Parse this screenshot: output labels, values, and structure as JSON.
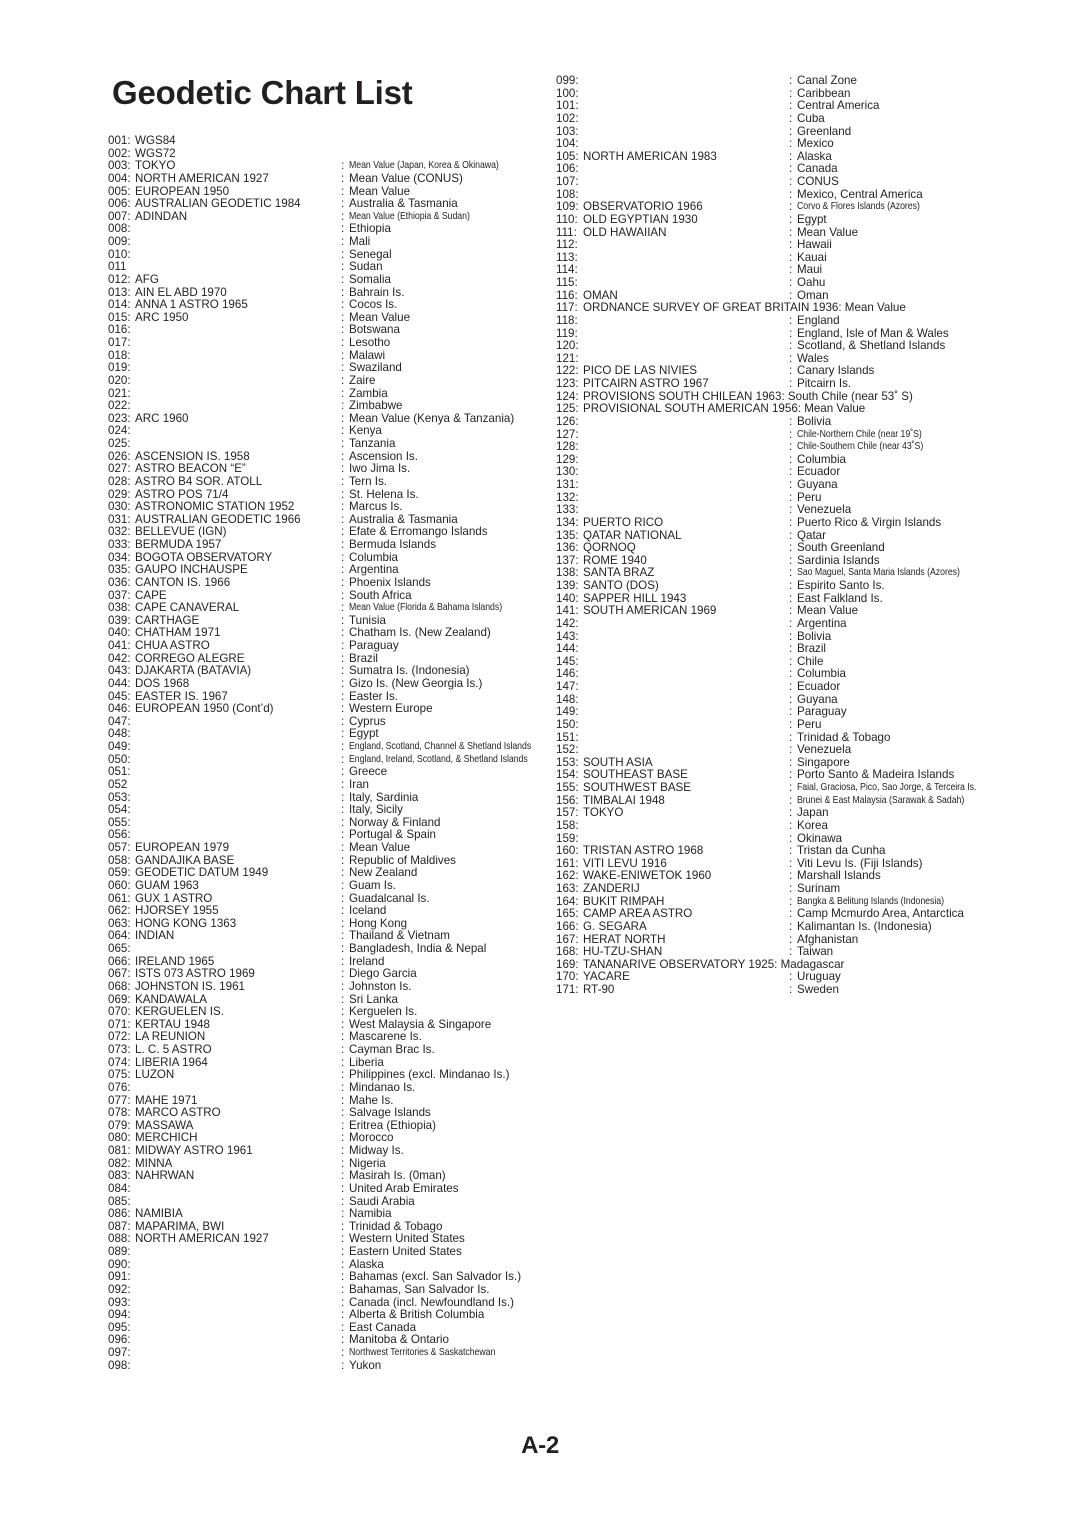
{
  "document": {
    "title": "Geodetic Chart List",
    "footer_page_label": "A-2",
    "separator": ":",
    "text_color": "#231f20",
    "background_color": "#ffffff"
  },
  "left_column": {
    "entries": [
      {
        "num": "001:",
        "name": "WGS84",
        "desc": ""
      },
      {
        "num": "002:",
        "name": "WGS72",
        "desc": ""
      },
      {
        "num": "003:",
        "name": "TOKYO",
        "desc": "Mean Value (Japan, Korea & Okinawa)",
        "condensed": true
      },
      {
        "num": "004:",
        "name": "NORTH AMERICAN 1927",
        "desc": "Mean Value (CONUS)"
      },
      {
        "num": "005:",
        "name": "EUROPEAN 1950",
        "desc": "Mean Value"
      },
      {
        "num": "006:",
        "name": "AUSTRALIAN GEODETIC 1984",
        "desc": "Australia & Tasmania"
      },
      {
        "num": "007:",
        "name": "ADINDAN",
        "desc": "Mean Value (Ethiopia & Sudan)",
        "condensed": true
      },
      {
        "num": "008:",
        "name": "",
        "desc": "Ethiopia"
      },
      {
        "num": "009:",
        "name": "",
        "desc": "Mali"
      },
      {
        "num": "010:",
        "name": "",
        "desc": "Senegal"
      },
      {
        "num": "011",
        "name": "",
        "desc": "Sudan"
      },
      {
        "num": "012:",
        "name": "AFG",
        "desc": "Somalia"
      },
      {
        "num": "013:",
        "name": "AIN EL ABD 1970",
        "desc": "Bahrain Is."
      },
      {
        "num": "014:",
        "name": "ANNA 1 ASTRO 1965",
        "desc": "Cocos Is."
      },
      {
        "num": "015:",
        "name": "ARC 1950",
        "desc": "Mean Value"
      },
      {
        "num": "016:",
        "name": "",
        "desc": "Botswana"
      },
      {
        "num": "017:",
        "name": "",
        "desc": "Lesotho"
      },
      {
        "num": "018:",
        "name": "",
        "desc": "Malawi"
      },
      {
        "num": "019:",
        "name": "",
        "desc": "Swaziland"
      },
      {
        "num": "020:",
        "name": "",
        "desc": "Zaire"
      },
      {
        "num": "021:",
        "name": "",
        "desc": "Zambia"
      },
      {
        "num": "022:",
        "name": "",
        "desc": "Zimbabwe"
      },
      {
        "num": "023:",
        "name": "ARC 1960",
        "desc": "Mean Value (Kenya & Tanzania)"
      },
      {
        "num": "024:",
        "name": "",
        "desc": "Kenya"
      },
      {
        "num": "025:",
        "name": "",
        "desc": "Tanzania"
      },
      {
        "num": "026:",
        "name": "ASCENSION IS. 1958",
        "desc": "Ascension Is."
      },
      {
        "num": "027:",
        "name": "ASTRO BEACON “E”",
        "desc": "Iwo Jima Is."
      },
      {
        "num": "028:",
        "name": "ASTRO B4 SOR. ATOLL",
        "desc": "Tern Is."
      },
      {
        "num": "029:",
        "name": "ASTRO POS 71/4",
        "desc": "St. Helena Is."
      },
      {
        "num": "030:",
        "name": "ASTRONOMIC STATION 1952",
        "desc": "Marcus Is."
      },
      {
        "num": "031:",
        "name": "AUSTRALIAN GEODETIC 1966",
        "desc": "Australia & Tasmania"
      },
      {
        "num": "032:",
        "name": "BELLEVUE (IGN)",
        "desc": "Efate & Erromango Islands"
      },
      {
        "num": "033:",
        "name": "BERMUDA 1957",
        "desc": "Bermuda Islands"
      },
      {
        "num": "034:",
        "name": "BOGOTA OBSERVATORY",
        "desc": "Columbia"
      },
      {
        "num": "035:",
        "name": "GAUPO INCHAUSPE",
        "desc": "Argentina"
      },
      {
        "num": "036:",
        "name": "CANTON IS. 1966",
        "desc": "Phoenix Islands"
      },
      {
        "num": "037:",
        "name": "CAPE",
        "desc": "South Africa"
      },
      {
        "num": "038:",
        "name": "CAPE CANAVERAL",
        "desc": "Mean Value (Florida & Bahama Islands)",
        "condensed": true
      },
      {
        "num": "039:",
        "name": "CARTHAGE",
        "desc": "Tunisia"
      },
      {
        "num": "040:",
        "name": "CHATHAM 1971",
        "desc": "Chatham Is. (New Zealand)"
      },
      {
        "num": "041:",
        "name": "CHUA ASTRO",
        "desc": "Paraguay"
      },
      {
        "num": "042:",
        "name": "CORREGO ALEGRE",
        "desc": "Brazil"
      },
      {
        "num": "043:",
        "name": "DJAKARTA (BATAVIA)",
        "desc": "Sumatra Is. (Indonesia)"
      },
      {
        "num": "044:",
        "name": "DOS 1968",
        "desc": "Gizo Is. (New Georgia Is.)"
      },
      {
        "num": "045:",
        "name": "EASTER IS. 1967",
        "desc": "Easter Is."
      },
      {
        "num": "046:",
        "name": "EUROPEAN 1950 (Cont’d)",
        "desc": "Western Europe"
      },
      {
        "num": "047:",
        "name": "",
        "desc": "Cyprus"
      },
      {
        "num": "048:",
        "name": "",
        "desc": "Egypt"
      },
      {
        "num": "049:",
        "name": "",
        "desc": "England, Scotland, Channel & Shetland Islands",
        "condensed": true
      },
      {
        "num": "050:",
        "name": "",
        "desc": "England, Ireland, Scotland, &  Shetland Islands",
        "condensed": true
      },
      {
        "num": "051:",
        "name": "",
        "desc": "Greece"
      },
      {
        "num": "052",
        "name": "",
        "desc": "Iran"
      },
      {
        "num": "053:",
        "name": "",
        "desc": "Italy, Sardinia"
      },
      {
        "num": "054:",
        "name": "",
        "desc": "Italy, Sicily"
      },
      {
        "num": "055:",
        "name": "",
        "desc": "Norway & Finland"
      },
      {
        "num": "056:",
        "name": "",
        "desc": "Portugal & Spain"
      },
      {
        "num": "057:",
        "name": "EUROPEAN 1979",
        "desc": "Mean Value"
      },
      {
        "num": "058:",
        "name": "GANDAJIKA BASE",
        "desc": "Republic of Maldives"
      },
      {
        "num": "059:",
        "name": "GEODETIC DATUM 1949",
        "desc": "New Zealand"
      },
      {
        "num": "060:",
        "name": "GUAM 1963",
        "desc": "Guam Is."
      },
      {
        "num": "061:",
        "name": "GUX 1 ASTRO",
        "desc": "Guadalcanal Is."
      },
      {
        "num": "062:",
        "name": "HJORSEY 1955",
        "desc": "Iceland"
      },
      {
        "num": "063:",
        "name": "HONG KONG 1363",
        "desc": "Hong Kong"
      },
      {
        "num": "064:",
        "name": "INDIAN",
        "desc": "Thailand & Vietnam"
      },
      {
        "num": "065:",
        "name": "",
        "desc": "Bangladesh, India & Nepal"
      },
      {
        "num": "066:",
        "name": "IRELAND 1965",
        "desc": "Ireland"
      },
      {
        "num": "067:",
        "name": "ISTS 073 ASTRO 1969",
        "desc": "Diego Garcia"
      },
      {
        "num": "068:",
        "name": "JOHNSTON IS. 1961",
        "desc": "Johnston Is."
      },
      {
        "num": "069:",
        "name": "KANDAWALA",
        "desc": "Sri Lanka"
      },
      {
        "num": "070:",
        "name": "KERGUELEN IS.",
        "desc": "Kerguelen Is."
      },
      {
        "num": "071:",
        "name": "KERTAU 1948",
        "desc": "West Malaysia & Singapore"
      },
      {
        "num": "072:",
        "name": "LA REUNION",
        "desc": "Mascarene Is."
      },
      {
        "num": "073:",
        "name": "L. C. 5 ASTRO",
        "desc": "Cayman Brac Is."
      },
      {
        "num": "074:",
        "name": "LIBERIA 1964",
        "desc": "Liberia"
      },
      {
        "num": "075:",
        "name": "LUZON",
        "desc": "Philippines (excl. Mindanao Is.)"
      },
      {
        "num": "076:",
        "name": "",
        "desc": "Mindanao Is."
      },
      {
        "num": "077:",
        "name": "MAHE 1971",
        "desc": "Mahe Is."
      },
      {
        "num": "078:",
        "name": "MARCO ASTRO",
        "desc": "Salvage Islands"
      },
      {
        "num": "079:",
        "name": "MASSAWA",
        "desc": "Eritrea (Ethiopia)"
      },
      {
        "num": "080:",
        "name": "MERCHICH",
        "desc": "Morocco"
      },
      {
        "num": "081:",
        "name": "MIDWAY ASTRO 1961",
        "desc": "Midway Is."
      },
      {
        "num": "082:",
        "name": "MINNA",
        "desc": "Nigeria"
      },
      {
        "num": "083:",
        "name": "NAHRWAN",
        "desc": "Masirah Is. (0man)"
      },
      {
        "num": "084:",
        "name": "",
        "desc": "United Arab Emirates"
      },
      {
        "num": "085:",
        "name": "",
        "desc": "Saudi Arabia"
      },
      {
        "num": "086:",
        "name": "NAMIBIA",
        "desc": "Namibia"
      },
      {
        "num": "087:",
        "name": "MAPARIMA, BWI",
        "desc": "Trinidad & Tobago"
      },
      {
        "num": "088:",
        "name": "NORTH AMERICAN 1927",
        "desc": "Western United States"
      },
      {
        "num": "089:",
        "name": "",
        "desc": "Eastern United States"
      },
      {
        "num": "090:",
        "name": "",
        "desc": "Alaska"
      },
      {
        "num": "091:",
        "name": "",
        "desc": "Bahamas (excl. San Salvador Is.)"
      },
      {
        "num": "092:",
        "name": "",
        "desc": "Bahamas, San Salvador Is."
      },
      {
        "num": "093:",
        "name": "",
        "desc": "Canada (incl. Newfoundland Is.)"
      },
      {
        "num": "094:",
        "name": "",
        "desc": "Alberta & British Columbia"
      },
      {
        "num": "095:",
        "name": "",
        "desc": "East Canada"
      },
      {
        "num": "096:",
        "name": "",
        "desc": "Manitoba & Ontario"
      },
      {
        "num": "097:",
        "name": "",
        "desc": "Northwest Territories & Saskatchewan",
        "condensed": true
      },
      {
        "num": "098:",
        "name": "",
        "desc": "Yukon"
      }
    ]
  },
  "right_column": {
    "entries": [
      {
        "num": "099:",
        "name": "",
        "desc": "Canal Zone"
      },
      {
        "num": "100:",
        "name": "",
        "desc": "Caribbean"
      },
      {
        "num": "101:",
        "name": "",
        "desc": "Central America"
      },
      {
        "num": "102:",
        "name": "",
        "desc": "Cuba"
      },
      {
        "num": "103:",
        "name": "",
        "desc": "Greenland"
      },
      {
        "num": "104:",
        "name": "",
        "desc": "Mexico"
      },
      {
        "num": "105:",
        "name": "NORTH AMERICAN 1983",
        "desc": "Alaska"
      },
      {
        "num": "106:",
        "name": "",
        "desc": "Canada"
      },
      {
        "num": "107:",
        "name": "",
        "desc": "CONUS"
      },
      {
        "num": "108:",
        "name": "",
        "desc": "Mexico, Central America"
      },
      {
        "num": "109:",
        "name": "OBSERVATORIO 1966",
        "desc": "Corvo & Flores Islands (Azores)",
        "condensed": true
      },
      {
        "num": "110:",
        "name": "OLD EGYPTIAN 1930",
        "desc": "Egypt"
      },
      {
        "num": "111:",
        "name": "OLD HAWAIIAN",
        "desc": "Mean Value"
      },
      {
        "num": "112:",
        "name": "",
        "desc": "Hawaii"
      },
      {
        "num": "113:",
        "name": "",
        "desc": "Kauai"
      },
      {
        "num": "114:",
        "name": "",
        "desc": "Maui"
      },
      {
        "num": "115:",
        "name": "",
        "desc": "Oahu"
      },
      {
        "num": "116:",
        "name": "OMAN",
        "desc": "Oman"
      },
      {
        "num": "117:",
        "wide": true,
        "inline": "ORDNANCE SURVEY OF GREAT BRITAIN 1936: Mean Value"
      },
      {
        "num": "118:",
        "name": "",
        "desc": "England"
      },
      {
        "num": "119:",
        "name": "",
        "desc": "England, Isle of Man & Wales"
      },
      {
        "num": "120:",
        "name": "",
        "desc": "Scotland, & Shetland Islands"
      },
      {
        "num": "121:",
        "name": "",
        "desc": "Wales"
      },
      {
        "num": "122:",
        "name": "PICO DE LAS NIVIES",
        "desc": "Canary Islands"
      },
      {
        "num": "123:",
        "name": "PITCAIRN ASTRO 1967",
        "desc": "Pitcairn Is."
      },
      {
        "num": "124:",
        "wide": true,
        "inline": "PROVISIONS SOUTH CHILEAN 1963: South Chile (near 53˚ S)"
      },
      {
        "num": "125:",
        "wide": true,
        "inline": "PROVISIONAL SOUTH AMERICAN 1956: Mean Value"
      },
      {
        "num": "126:",
        "name": "",
        "desc": "Bolivia"
      },
      {
        "num": "127:",
        "name": "",
        "desc": "Chile-Northern Chile (near 19˚S)",
        "condensed": true
      },
      {
        "num": "128:",
        "name": "",
        "desc": "Chile-Southern Chile (near 43˚S)",
        "condensed": true
      },
      {
        "num": "129:",
        "name": "",
        "desc": "Columbia"
      },
      {
        "num": "130:",
        "name": "",
        "desc": "Ecuador"
      },
      {
        "num": "131:",
        "name": "",
        "desc": "Guyana"
      },
      {
        "num": "132:",
        "name": "",
        "desc": "Peru"
      },
      {
        "num": "133:",
        "name": "",
        "desc": "Venezuela"
      },
      {
        "num": "134:",
        "name": "PUERTO RICO",
        "desc": "Puerto Rico & Virgin Islands"
      },
      {
        "num": "135:",
        "name": "QATAR NATIONAL",
        "desc": "Qatar"
      },
      {
        "num": "136:",
        "name": "QORNOQ",
        "desc": "South Greenland"
      },
      {
        "num": "137:",
        "name": "ROME 1940",
        "desc": "Sardinia Islands"
      },
      {
        "num": "138:",
        "name": "SANTA BRAZ",
        "desc": "Sao Maguel, Santa Maria Islands (Azores)",
        "condensed": true
      },
      {
        "num": "139:",
        "name": "SANTO (DOS)",
        "desc": "Espirito Santo Is."
      },
      {
        "num": "140:",
        "name": "SAPPER HILL 1943",
        "desc": "East Falkland Is."
      },
      {
        "num": "141:",
        "name": "SOUTH AMERICAN 1969",
        "desc": "Mean Value"
      },
      {
        "num": "142:",
        "name": "",
        "desc": "Argentina"
      },
      {
        "num": "143:",
        "name": "",
        "desc": "Bolivia"
      },
      {
        "num": "144:",
        "name": "",
        "desc": "Brazil"
      },
      {
        "num": "145:",
        "name": "",
        "desc": "Chile"
      },
      {
        "num": "146:",
        "name": "",
        "desc": "Columbia"
      },
      {
        "num": "147:",
        "name": "",
        "desc": "Ecuador"
      },
      {
        "num": "148:",
        "name": "",
        "desc": "Guyana"
      },
      {
        "num": "149:",
        "name": "",
        "desc": "Paraguay"
      },
      {
        "num": "150:",
        "name": "",
        "desc": "Peru"
      },
      {
        "num": "151:",
        "name": "",
        "desc": "Trinidad & Tobago"
      },
      {
        "num": "152:",
        "name": "",
        "desc": "Venezuela"
      },
      {
        "num": "153:",
        "name": "SOUTH ASIA",
        "desc": "Singapore"
      },
      {
        "num": "154:",
        "name": "SOUTHEAST BASE",
        "desc": "Porto Santo & Madeira Islands"
      },
      {
        "num": "155:",
        "name": "SOUTHWEST BASE",
        "desc": "Faial, Graciosa, Pico, Sao Jorge, & Terceira Is.",
        "condensed": true
      },
      {
        "num": "156:",
        "name": "TIMBALAI 1948",
        "desc": "Brunei & East Malaysia (Sarawak & Sadah)",
        "condensed": true
      },
      {
        "num": "157:",
        "name": "TOKYO",
        "desc": "Japan"
      },
      {
        "num": "158:",
        "name": "",
        "desc": "Korea"
      },
      {
        "num": "159:",
        "name": "",
        "desc": "Okinawa"
      },
      {
        "num": "160:",
        "name": "TRISTAN ASTRO 1968",
        "desc": "Tristan da Cunha"
      },
      {
        "num": "161:",
        "name": "VITI LEVU 1916",
        "desc": "Viti Levu Is. (Fiji Islands)"
      },
      {
        "num": "162:",
        "name": "WAKE-ENIWETOK 1960",
        "desc": "Marshall Islands"
      },
      {
        "num": "163:",
        "name": "ZANDERIJ",
        "desc": "Surinam"
      },
      {
        "num": "164:",
        "name": "BUKIT RIMPAH",
        "desc": "Bangka & Belitung Islands (Indonesia)",
        "condensed": true
      },
      {
        "num": "165:",
        "name": "CAMP AREA ASTRO",
        "desc": "Camp Mcmurdo Area, Antarctica"
      },
      {
        "num": "166:",
        "name": "G. SEGARA",
        "desc": "Kalimantan Is. (Indonesia)"
      },
      {
        "num": "167:",
        "name": "HERAT NORTH",
        "desc": "Afghanistan"
      },
      {
        "num": "168:",
        "name": "HU-TZU-SHAN",
        "desc": "Taiwan"
      },
      {
        "num": "169:",
        "wide": true,
        "inline": "TANANARIVE OBSERVATORY 1925: Madagascar"
      },
      {
        "num": "170:",
        "name": "YACARE",
        "desc": "Uruguay"
      },
      {
        "num": "171:",
        "name": "RT-90",
        "desc": "Sweden"
      }
    ]
  }
}
